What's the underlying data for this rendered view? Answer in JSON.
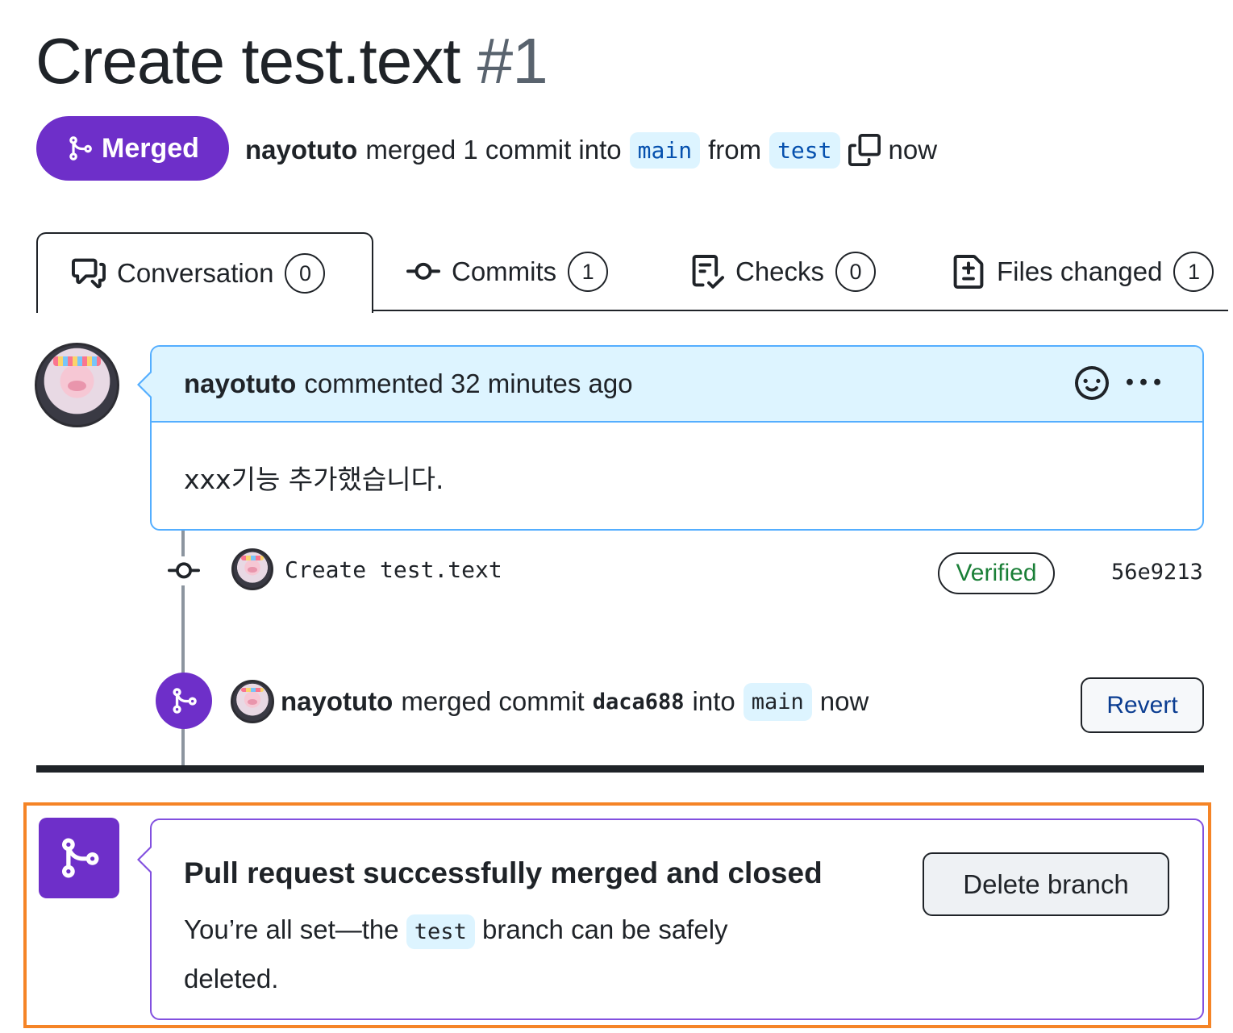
{
  "pr": {
    "title": "Create test.text",
    "number": "#1",
    "state_label": "Merged",
    "author": "nayotuto",
    "merged_text": "merged 1 commit into",
    "base_branch": "main",
    "from_text": "from",
    "head_branch": "test",
    "time": "now"
  },
  "tabs": [
    {
      "label": "Conversation",
      "count": "0",
      "icon": "comment-discussion-icon"
    },
    {
      "label": "Commits",
      "count": "1",
      "icon": "git-commit-icon"
    },
    {
      "label": "Checks",
      "count": "0",
      "icon": "checklist-icon"
    },
    {
      "label": "Files changed",
      "count": "1",
      "icon": "file-diff-icon"
    }
  ],
  "comment": {
    "author": "nayotuto",
    "meta": "commented 32 minutes ago",
    "body": "xxx기능 추가했습니다."
  },
  "commit": {
    "message": "Create test.text",
    "verified_label": "Verified",
    "sha": "56e9213"
  },
  "merge_event": {
    "author": "nayotuto",
    "text1": "merged commit",
    "sha": "daca688",
    "text2": "into",
    "branch": "main",
    "time": "now",
    "revert_label": "Revert"
  },
  "merged_box": {
    "title": "Pull request successfully merged and closed",
    "desc_pre": "You’re all set—the",
    "branch": "test",
    "desc_post": "branch can be safely deleted.",
    "delete_label": "Delete branch"
  },
  "colors": {
    "merged_purple": "#6e2fc9",
    "accent_blue": "#54aeff",
    "verified_green": "#1a7f37",
    "highlight_orange": "#f58426"
  }
}
